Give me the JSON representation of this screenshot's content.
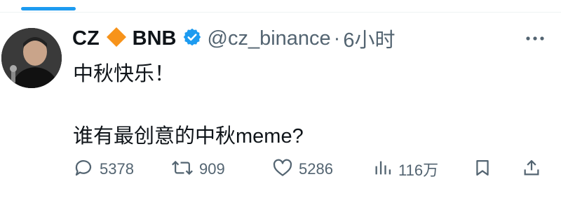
{
  "tweet": {
    "author_name": "CZ",
    "author_badge": "BNB",
    "handle": "@cz_binance",
    "separator": "·",
    "time": "6小时",
    "text_line1": "中秋快乐！",
    "text_line2": "谁有最创意的中秋meme?"
  },
  "actions": {
    "replies": "5378",
    "retweets": "909",
    "likes": "5286",
    "views": "116万"
  },
  "icons": {
    "diamond": "diamond-icon",
    "verified": "verified-badge-icon",
    "more": "more-icon",
    "reply": "reply-icon",
    "retweet": "retweet-icon",
    "like": "heart-icon",
    "views": "analytics-icon",
    "bookmark": "bookmark-icon",
    "share": "share-icon"
  },
  "colors": {
    "accent": "#1d9bf0",
    "diamond": "#f7931a",
    "secondary_text": "#536471"
  }
}
